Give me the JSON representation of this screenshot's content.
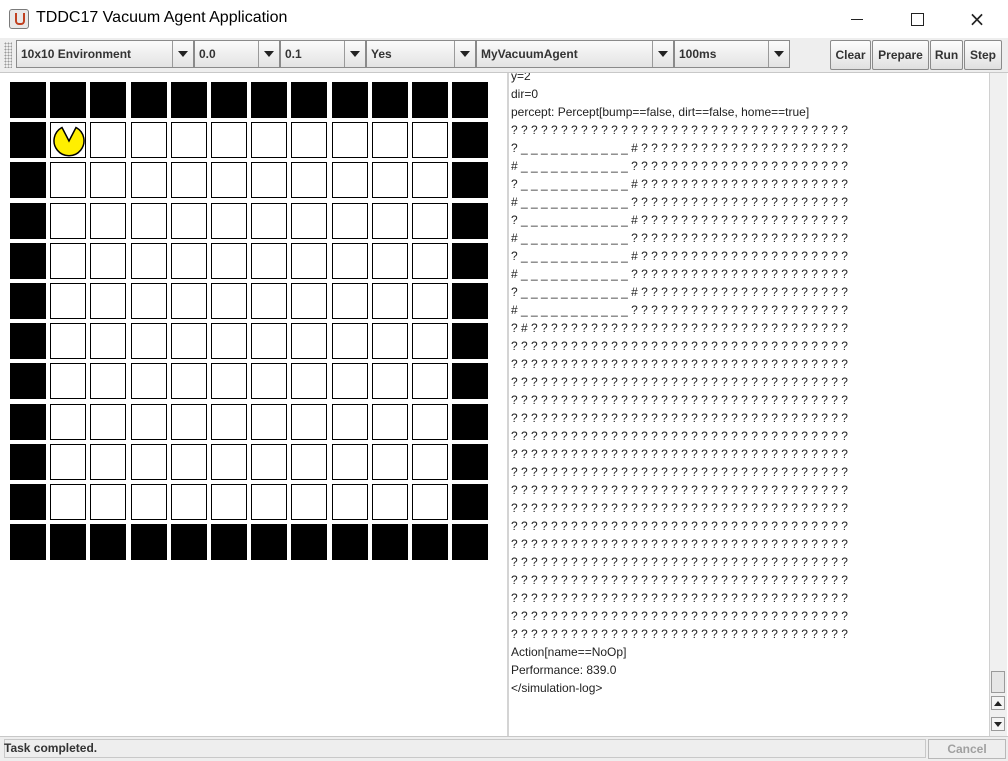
{
  "window": {
    "title": "TDDC17 Vacuum Agent Application",
    "controls": {
      "minimize": "minimize-icon",
      "maximize": "maximize-icon",
      "close": "×"
    }
  },
  "toolbar": {
    "combos": [
      {
        "name": "environment-select",
        "value": "10x10 Environment"
      },
      {
        "name": "dirt-probability-select",
        "value": "0.0"
      },
      {
        "name": "random-select",
        "value": "0.1"
      },
      {
        "name": "yes-select",
        "value": "Yes"
      },
      {
        "name": "agent-select",
        "value": "MyVacuumAgent"
      },
      {
        "name": "delay-select",
        "value": "100ms"
      }
    ],
    "buttons": {
      "clear": "Clear",
      "prepare": "Prepare",
      "run": "Run",
      "step": "Step"
    }
  },
  "environment": {
    "grid": [
      "WWWWWWWWWWWW",
      "WAFFFFFFFFFW",
      "WFFFFFFFFFFW",
      "WFFFFFFFFFFW",
      "WFFFFFFFFFFW",
      "WFFFFFFFFFFW",
      "WFFFFFFFFFFW",
      "WFFFFFFFFFFW",
      "WFFFFFFFFFFW",
      "WFFFFFFFFFFW",
      "WFFFFFFFFFFW",
      "WWWWWWWWWWWW"
    ],
    "agent_color": "#FFEF00",
    "wall_color": "#000000"
  },
  "log": {
    "lines": [
      "y=2",
      "dir=0",
      "percept: Percept[bump==false, dirt==false, home==true]",
      "? ? ? ? ? ? ? ? ? ? ? ? ? ? ? ? ? ? ? ? ? ? ? ? ? ? ? ? ? ? ? ? ? ?",
      "? _ _ _ _ _ _ _ _ _ _ _ # ? ? ? ? ? ? ? ? ? ? ? ? ? ? ? ? ? ? ? ? ?",
      "# _ _ _ _ _ _ _ _ _ _ _ ? ? ? ? ? ? ? ? ? ? ? ? ? ? ? ? ? ? ? ? ? ?",
      "? _ _ _ _ _ _ _ _ _ _ _ # ? ? ? ? ? ? ? ? ? ? ? ? ? ? ? ? ? ? ? ? ?",
      "# _ _ _ _ _ _ _ _ _ _ _ ? ? ? ? ? ? ? ? ? ? ? ? ? ? ? ? ? ? ? ? ? ?",
      "? _ _ _ _ _ _ _ _ _ _ _ # ? ? ? ? ? ? ? ? ? ? ? ? ? ? ? ? ? ? ? ? ?",
      "# _ _ _ _ _ _ _ _ _ _ _ ? ? ? ? ? ? ? ? ? ? ? ? ? ? ? ? ? ? ? ? ? ?",
      "? _ _ _ _ _ _ _ _ _ _ _ # ? ? ? ? ? ? ? ? ? ? ? ? ? ? ? ? ? ? ? ? ?",
      "# _ _ _ _ _ _ _ _ _ _ _ ? ? ? ? ? ? ? ? ? ? ? ? ? ? ? ? ? ? ? ? ? ?",
      "? _ _ _ _ _ _ _ _ _ _ _ # ? ? ? ? ? ? ? ? ? ? ? ? ? ? ? ? ? ? ? ? ?",
      "# _ _ _ _ _ _ _ _ _ _ _ ? ? ? ? ? ? ? ? ? ? ? ? ? ? ? ? ? ? ? ? ? ?",
      "? # ? ? ? ? ? ? ? ? ? ? ? ? ? ? ? ? ? ? ? ? ? ? ? ? ? ? ? ? ? ? ? ?",
      "? ? ? ? ? ? ? ? ? ? ? ? ? ? ? ? ? ? ? ? ? ? ? ? ? ? ? ? ? ? ? ? ? ?",
      "? ? ? ? ? ? ? ? ? ? ? ? ? ? ? ? ? ? ? ? ? ? ? ? ? ? ? ? ? ? ? ? ? ?",
      "? ? ? ? ? ? ? ? ? ? ? ? ? ? ? ? ? ? ? ? ? ? ? ? ? ? ? ? ? ? ? ? ? ?",
      "? ? ? ? ? ? ? ? ? ? ? ? ? ? ? ? ? ? ? ? ? ? ? ? ? ? ? ? ? ? ? ? ? ?",
      "? ? ? ? ? ? ? ? ? ? ? ? ? ? ? ? ? ? ? ? ? ? ? ? ? ? ? ? ? ? ? ? ? ?",
      "? ? ? ? ? ? ? ? ? ? ? ? ? ? ? ? ? ? ? ? ? ? ? ? ? ? ? ? ? ? ? ? ? ?",
      "? ? ? ? ? ? ? ? ? ? ? ? ? ? ? ? ? ? ? ? ? ? ? ? ? ? ? ? ? ? ? ? ? ?",
      "? ? ? ? ? ? ? ? ? ? ? ? ? ? ? ? ? ? ? ? ? ? ? ? ? ? ? ? ? ? ? ? ? ?",
      "? ? ? ? ? ? ? ? ? ? ? ? ? ? ? ? ? ? ? ? ? ? ? ? ? ? ? ? ? ? ? ? ? ?",
      "? ? ? ? ? ? ? ? ? ? ? ? ? ? ? ? ? ? ? ? ? ? ? ? ? ? ? ? ? ? ? ? ? ?",
      "? ? ? ? ? ? ? ? ? ? ? ? ? ? ? ? ? ? ? ? ? ? ? ? ? ? ? ? ? ? ? ? ? ?",
      "? ? ? ? ? ? ? ? ? ? ? ? ? ? ? ? ? ? ? ? ? ? ? ? ? ? ? ? ? ? ? ? ? ?",
      "? ? ? ? ? ? ? ? ? ? ? ? ? ? ? ? ? ? ? ? ? ? ? ? ? ? ? ? ? ? ? ? ? ?",
      "? ? ? ? ? ? ? ? ? ? ? ? ? ? ? ? ? ? ? ? ? ? ? ? ? ? ? ? ? ? ? ? ? ?",
      "? ? ? ? ? ? ? ? ? ? ? ? ? ? ? ? ? ? ? ? ? ? ? ? ? ? ? ? ? ? ? ? ? ?",
      "? ? ? ? ? ? ? ? ? ? ? ? ? ? ? ? ? ? ? ? ? ? ? ? ? ? ? ? ? ? ? ? ? ?",
      "? ? ? ? ? ? ? ? ? ? ? ? ? ? ? ? ? ? ? ? ? ? ? ? ? ? ? ? ? ? ? ? ? ?",
      "Action[name==NoOp]",
      "Performance: 839.0",
      "</simulation-log>"
    ]
  },
  "status": {
    "message": "Task completed.",
    "cancel": "Cancel"
  }
}
